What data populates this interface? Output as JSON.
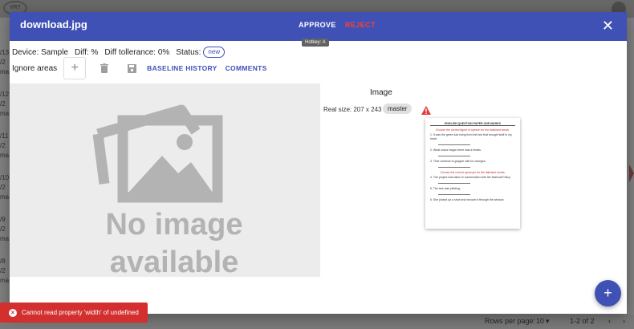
{
  "background": {
    "logo_text": "VRT",
    "row_snippets": [
      "/13",
      "/2",
      "ma",
      "/12",
      "/2",
      "ma",
      "/11",
      "/2",
      "ma",
      "/10",
      "/2",
      "ma",
      "/9",
      "/2",
      "ma",
      "/8",
      "/2",
      "ma"
    ],
    "footer": {
      "rows_per_page_label": "Rows per page:",
      "rows_per_page_value": "10",
      "range": "1-2 of 2"
    }
  },
  "dialog": {
    "title": "download.jpg",
    "approve_label": "APPROVE",
    "reject_label": "REJECT",
    "tooltip": "Hotkey: A",
    "info": {
      "device": "Device: Sample",
      "diff": "Diff: %",
      "tolerance": "Diff tollerance: 0%",
      "status_label": "Status:",
      "status_value": "new"
    },
    "toolbar": {
      "ignore_areas_label": "Ignore areas",
      "baseline_history_label": "BASELINE HISTORY",
      "comments_label": "COMMENTS"
    },
    "placeholder": {
      "line1": "No image",
      "line2": "available"
    },
    "image_panel": {
      "heading": "Image",
      "real_size": "Real size: 207 x 243",
      "branch_chip": "master"
    },
    "thumbnail_doc": {
      "header": "ENGLISH QUESTION PAPER ONE MARKS",
      "instruction1": "Choose the correct figure of speech for the italicised words.",
      "items": [
        "1. It was the green lust rising from the bed that brought stuff to my heart.",
        "2. What colour began there was a heads.",
        "3. Time continue to grapple with for changes."
      ],
      "instruction2": "Choose the correct synonym for the italicised words.",
      "items2": [
        "4. The project was taken in conservation with the National Policy.",
        "5. The tree was yielding.",
        "6. She picked up a shoe and whoosh it through the window."
      ]
    }
  },
  "colors": {
    "primary": "#3f51b5",
    "reject": "#f44336",
    "error_snackbar": "#d32f2f",
    "warning": "#e53935"
  },
  "snackbar": {
    "message": "Cannot read property 'width' of undefined"
  }
}
